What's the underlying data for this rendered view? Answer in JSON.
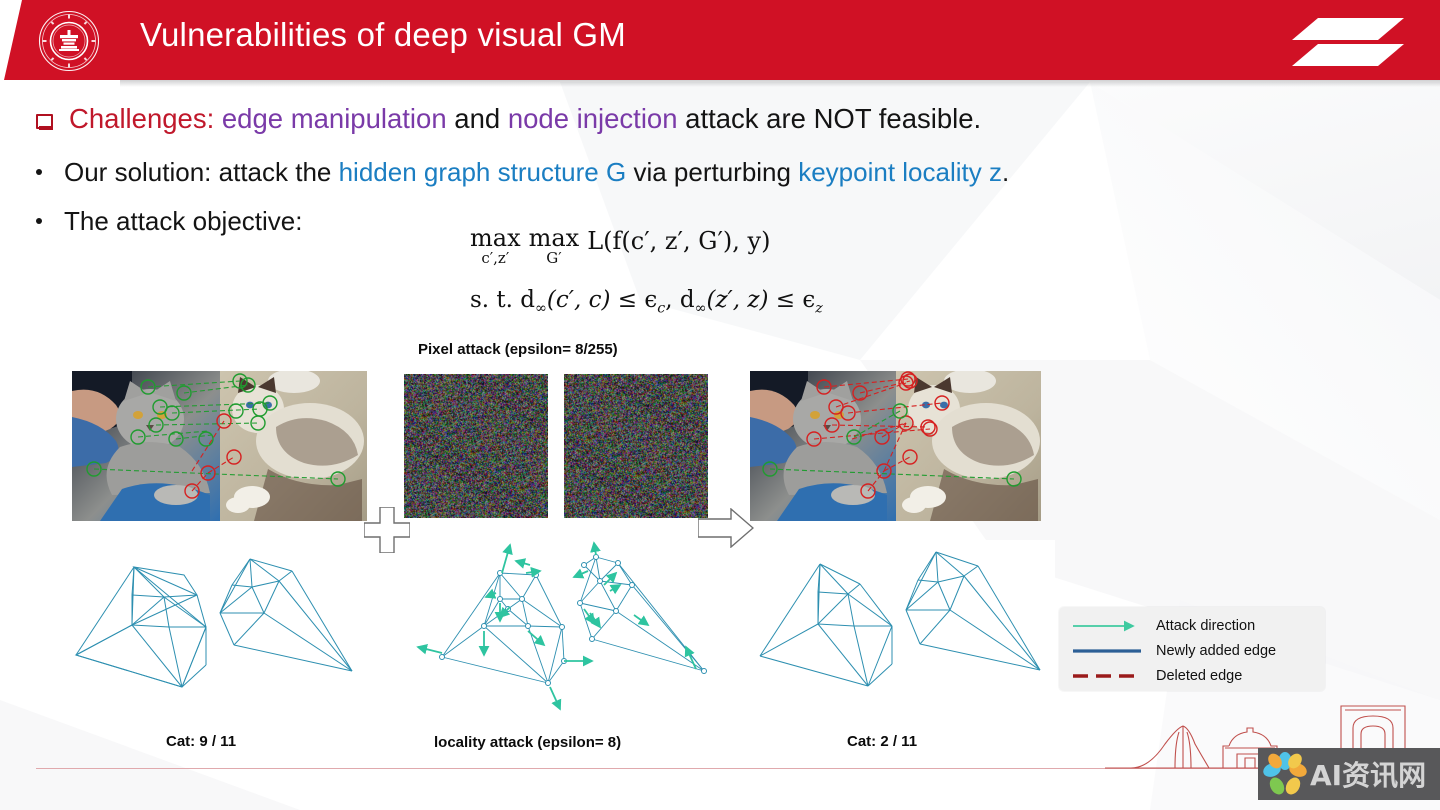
{
  "header": {
    "title": "Vulnerabilities of deep visual GM",
    "logo_name": "sjtu-seal-logo",
    "deco_name": "header-parallelogram-decoration",
    "bar_color": "#d01125",
    "title_color": "#ffffff"
  },
  "body": {
    "bullet1": {
      "marker": "❑",
      "segments": [
        {
          "text": "Challenges:",
          "color": "#c0182b"
        },
        {
          "text": " edge manipulation",
          "color": "#7a3aa8"
        },
        {
          "text": " and ",
          "color": "#141414"
        },
        {
          "text": "node injection",
          "color": "#7a3aa8"
        },
        {
          "text": " attack are NOT feasible.",
          "color": "#141414"
        }
      ]
    },
    "bullet2": {
      "marker": "•",
      "segments": [
        {
          "text": "Our solution: attack the ",
          "color": "#141414"
        },
        {
          "text": "hidden graph structure G",
          "color": "#1b7ec2"
        },
        {
          "text": " via perturbing ",
          "color": "#141414"
        },
        {
          "text": "keypoint locality z",
          "color": "#1b7ec2"
        },
        {
          "text": ".",
          "color": "#141414"
        }
      ]
    },
    "bullet3": {
      "marker": "•",
      "segments": [
        {
          "text": "The attack objective:",
          "color": "#141414"
        }
      ]
    }
  },
  "formula": {
    "max_op_1": "max",
    "max_sub_1": "c′,z′",
    "max_op_2": "max",
    "max_sub_2": "G′",
    "objective": "L(f(c′, z′, G′), y)",
    "constraint": "s. t. d∞(c′, c) ≤ ϵc, d∞(z′, z) ≤ ϵz",
    "constraint_parts": {
      "prefix": "s. t. ",
      "d1": "d",
      "d1_sub": "∞",
      "d1_args": "(c′, c) ≤ ",
      "eps1": "ϵ",
      "eps1_sub": "c",
      "comma": ", ",
      "d2": "d",
      "d2_sub": "∞",
      "d2_args": "(z′, z) ≤ ",
      "eps2": "ϵ",
      "eps2_sub": "z"
    }
  },
  "figure": {
    "caption_pixel_attack": "Pixel attack (epsilon= 8/255)",
    "caption_locality_attack": "locality attack (epsilon= 8)",
    "caption_left_result": "Cat: 9 / 11",
    "caption_right_result": "Cat: 2 / 11",
    "plus_symbol_name": "plus-operator-symbol",
    "arrow_symbol_name": "right-arrow-symbol",
    "photo_left_name": "cat-keypoint-match-before-attack",
    "photo_right_name": "cat-keypoint-match-after-attack",
    "noise_a_name": "adversarial-noise-image-a",
    "noise_b_name": "adversarial-noise-image-b",
    "graph_left_name": "keypoint-graph-original",
    "graph_mid_name": "keypoint-graph-with-attack-directions",
    "graph_right_name": "keypoint-graph-perturbed"
  },
  "legend": {
    "items": [
      {
        "label": "Attack direction",
        "color": "#3fcaa0",
        "style": "arrow"
      },
      {
        "label": "Newly added edge",
        "color": "#2c5f96",
        "style": "solid"
      },
      {
        "label": "Deleted edge",
        "color": "#9b1b1b",
        "style": "dashed"
      }
    ],
    "background": "#f1f1f1"
  },
  "decoration": {
    "skyline_name": "sjtu-campus-skyline-outline",
    "skyline_color": "#c0504d",
    "watermark_text": "AI资讯网",
    "watermark_logo_name": "flower-watermark-logo",
    "watermark_bg": "#58585a"
  },
  "colors": {
    "accent_red": "#d01125",
    "link_blue": "#1b7ec2",
    "highlight_purple": "#7a3aa8",
    "graph_teal": "#2d8fb0",
    "arrow_green": "#2ec4a0",
    "marker_green": "#1f9c2f",
    "marker_red": "#d62020"
  }
}
